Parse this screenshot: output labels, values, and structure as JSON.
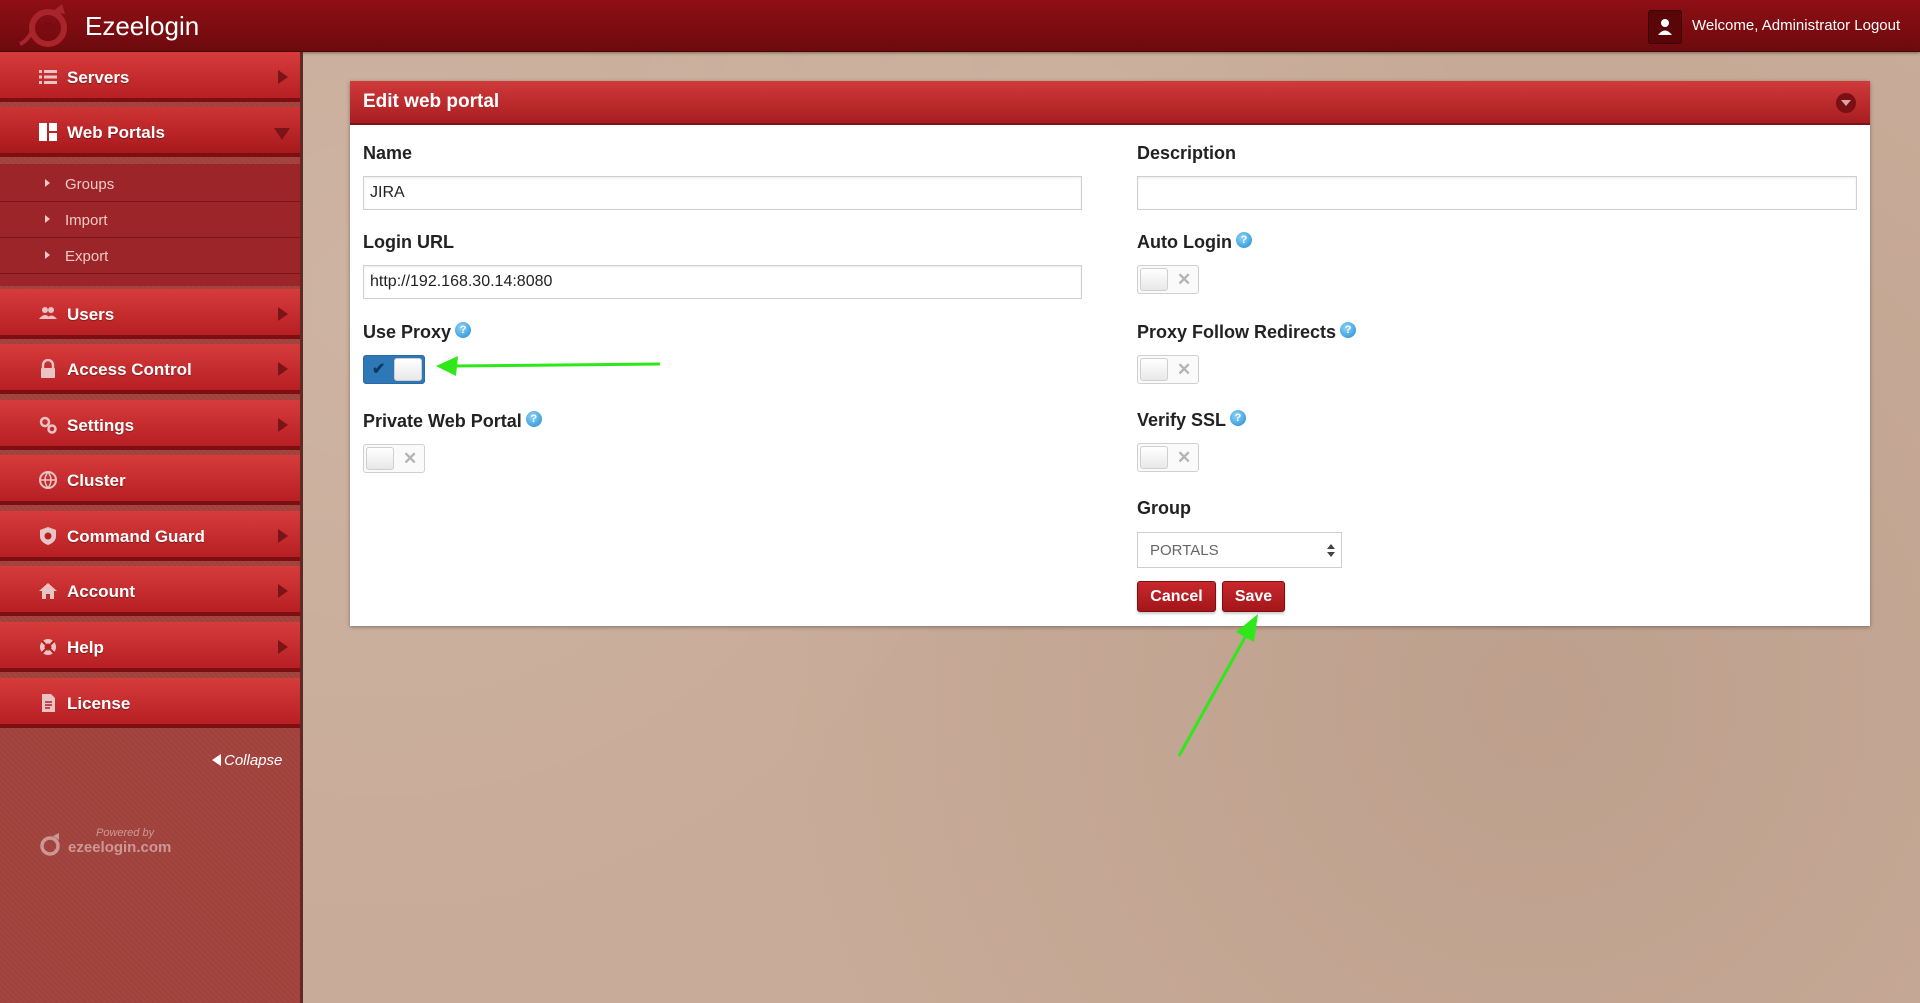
{
  "app": {
    "title": "Ezeelogin"
  },
  "header": {
    "welcome": "Welcome, Administrator",
    "logout": "Logout"
  },
  "sidebar": {
    "items": [
      {
        "label": "Servers",
        "icon": "list-icon"
      },
      {
        "label": "Web Portals",
        "icon": "grid-icon",
        "expanded": true,
        "subitems": [
          {
            "label": "Groups"
          },
          {
            "label": "Import"
          },
          {
            "label": "Export"
          }
        ]
      },
      {
        "label": "Users",
        "icon": "users-icon"
      },
      {
        "label": "Access Control",
        "icon": "lock-icon"
      },
      {
        "label": "Settings",
        "icon": "gears-icon"
      },
      {
        "label": "Cluster",
        "icon": "ball-icon"
      },
      {
        "label": "Command Guard",
        "icon": "shield-icon"
      },
      {
        "label": "Account",
        "icon": "home-icon"
      },
      {
        "label": "Help",
        "icon": "lifebuoy-icon"
      },
      {
        "label": "License",
        "icon": "document-icon"
      }
    ],
    "collapse": "Collapse",
    "powered_by": "Powered by",
    "powered_site": "ezeelogin.com"
  },
  "form": {
    "title": "Edit web portal",
    "name": {
      "label": "Name",
      "value": "JIRA"
    },
    "login_url": {
      "label": "Login URL",
      "value": "http://192.168.30.14:8080"
    },
    "use_proxy": {
      "label": "Use Proxy",
      "on": true
    },
    "private_web_portal": {
      "label": "Private Web Portal",
      "on": false
    },
    "description": {
      "label": "Description",
      "value": ""
    },
    "auto_login": {
      "label": "Auto Login",
      "on": false
    },
    "proxy_follow_redirects": {
      "label": "Proxy Follow Redirects",
      "on": false
    },
    "verify_ssl": {
      "label": "Verify SSL",
      "on": false
    },
    "group": {
      "label": "Group",
      "selected": "PORTALS"
    },
    "cancel": "Cancel",
    "save": "Save"
  },
  "colors": {
    "brand_dark": "#7a0b10",
    "accent_red": "#c8282c",
    "annotation_arrow": "#2ee81a",
    "toggle_on": "#2f78b8"
  }
}
